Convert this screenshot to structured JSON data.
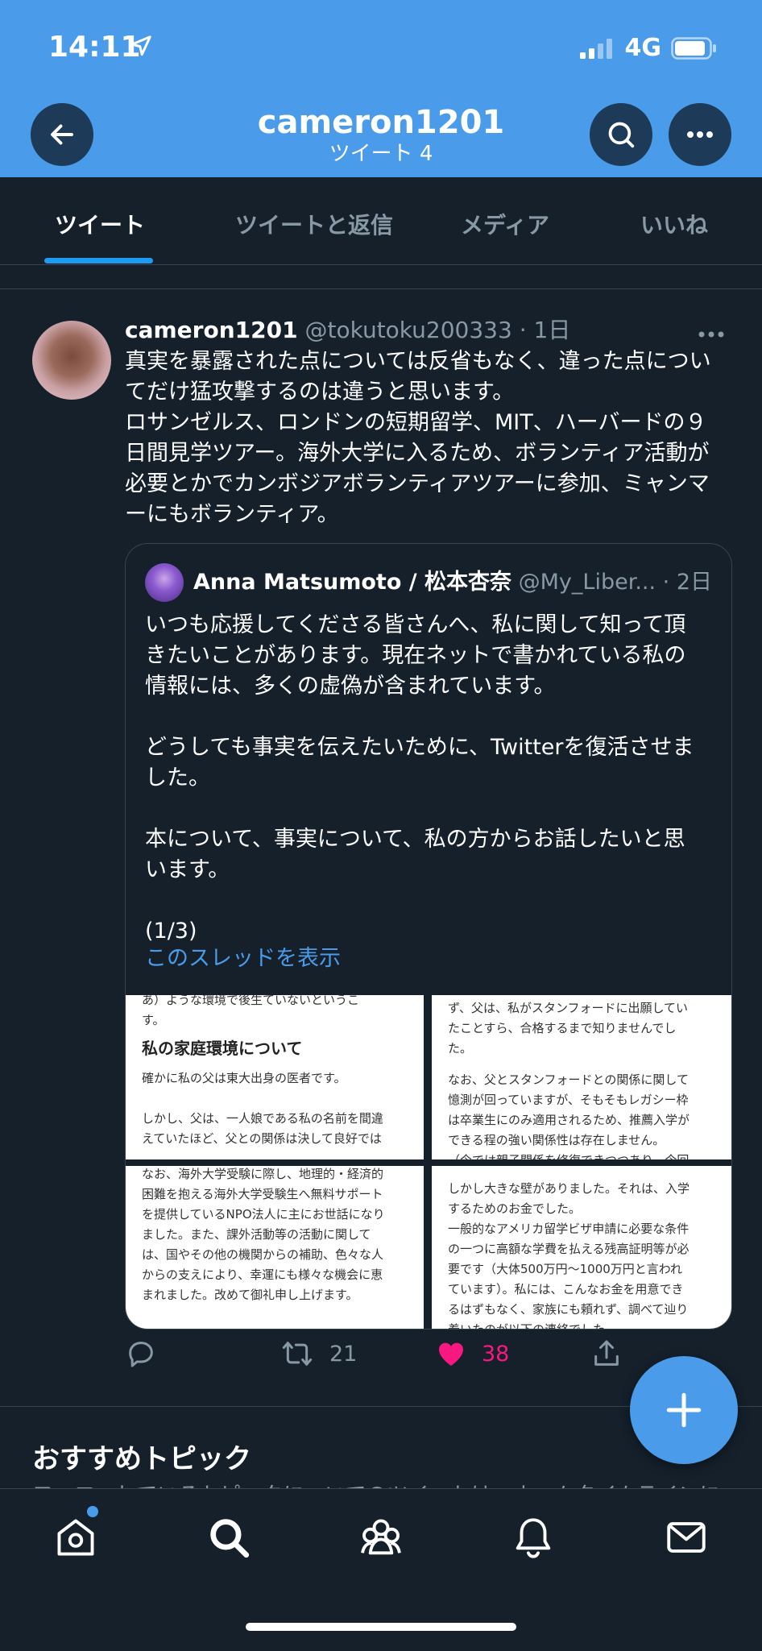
{
  "status_bar": {
    "time": "14:11",
    "network": "4G",
    "location_icon": "location-arrow-icon",
    "signal_icon": "signal-bars-icon",
    "battery_icon": "battery-icon"
  },
  "header": {
    "back_icon": "back-arrow-icon",
    "title": "cameron1201",
    "subtitle": "ツイート 4",
    "search_icon": "search-icon",
    "more_icon": "more-horizontal-icon",
    "bg_color": "#4a9be9"
  },
  "tabs": [
    {
      "label": "ツイート",
      "active": true
    },
    {
      "label": "ツイートと返信",
      "active": false
    },
    {
      "label": "メディア",
      "active": false
    },
    {
      "label": "いいね",
      "active": false
    }
  ],
  "tweet": {
    "name": "cameron1201",
    "handle": "@tokutoku200333",
    "time": "· 1日",
    "text": "真実を暴露された点については反省もなく、違った点につい\nてだけ猛攻撃するのは違うと思います。\nロサンゼルス、ロンドンの短期留学、MIT、ハーバードの９\n日間見学ツアー。海外大学に入るため、ボランティア活動が\n必要とかでカンボジアボランティアツアーに参加、ミャンマ\nーにもボランティア。",
    "quote": {
      "name": "Anna Matsumoto / 松本杏奈",
      "handle": "@My_Liber...",
      "time": "· 2日",
      "text": "いつも応援してくださる皆さんへ、私に関して知って頂\nきたいことがあります。現在ネットで書かれている私の\n情報には、多くの虚偽が含まれています。\n\nどうしても事実を伝えたいために、Twitterを復活させま\nした。\n\n本について、事実について、私の方からお話したいと思\nいます。\n\n(1/3)",
      "thread_link": "このスレッドを表示",
      "images": [
        {
          "heading": "私の家庭環境について",
          "top": "あ）ような環境で後生ていないというこ\nす。",
          "body": "確かに私の父は東大出身の医者です。\n\nしかし、父は、一人娘である私の名前を間違\nえていたほど、父との関係は決して良好では"
        },
        {
          "heading": "",
          "top": "ず、父は、私がスタンフォードに出願してい\nたことすら、合格するまで知りませんでし\nた。",
          "body": "なお、父とスタンフォードとの関係に関して\n憶測が回っていますが、そもそもレガシー枠\nは卒業生にのみ適用されるため、推薦入学が\nできる程の強い関係性は存在しません。\n（今では親子関係を修復できつつあり、今回"
        },
        {
          "heading": "",
          "top": "",
          "body": "なお、海外大学受験に際し、地理的・経済的\n困難を抱える海外大学受験生へ無料サポート\nを提供しているNPO法人に主にお世話になり\nました。また、課外活動等の活動に関して\nは、国やその他の機関からの補助、色々な人\nからの支えにより、幸運にも様々な機会に恵\nまれました。改めて御礼申し上げます。"
        },
        {
          "heading": "",
          "top": "",
          "body": "しかし大きな壁がありました。それは、入学\nするためのお金でした。\n一般的なアメリカ留学ビザ申請に必要な条件\nの一つに高額な学費を払える残高証明等が必\n要です（大体500万円〜1000万円と言われ\nています）。私には、こんなお金を用意でき\nるはずもなく、家族にも頼れず、調べて辿り\n着いたのが以下の連絡でした"
        }
      ]
    },
    "actions": {
      "reply_icon": "reply-icon",
      "retweet_icon": "retweet-icon",
      "retweet_count": "21",
      "like_icon": "heart-filled-icon",
      "like_count": "38",
      "share_icon": "share-icon"
    }
  },
  "recommended": {
    "title": "おすすめトピック",
    "peek": "フォローしているトピックについてのツイートは、ホームタイムラインに表示され"
  },
  "fab": {
    "icon": "plus-icon"
  },
  "bottom_nav": [
    {
      "icon": "home-icon"
    },
    {
      "icon": "search-icon"
    },
    {
      "icon": "communities-icon"
    },
    {
      "icon": "bell-icon"
    },
    {
      "icon": "mail-icon"
    }
  ]
}
